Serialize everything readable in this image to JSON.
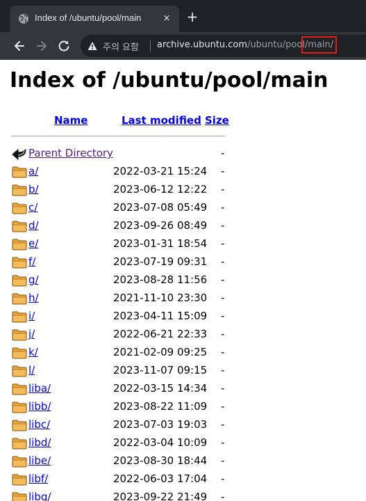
{
  "browser": {
    "tab_title": "Index of /ubuntu/pool/main",
    "tab_close": "×",
    "new_tab": "+",
    "security_warning": "주의 요함",
    "url_host": "archive.ubuntu.com",
    "url_path_pre": "/ubuntu/pool",
    "url_path_marked": "/main/",
    "accent_annotation_color": "#e01f1f"
  },
  "page": {
    "heading": "Index of /ubuntu/pool/main",
    "columns": {
      "name": "Name",
      "modified": "Last modified",
      "size": "Size"
    },
    "parent": {
      "label": "Parent Directory",
      "size": "-"
    },
    "entries": [
      {
        "name": "a/",
        "modified": "2022-03-21 15:24",
        "size": "-"
      },
      {
        "name": "b/",
        "modified": "2023-06-12 12:22",
        "size": "-"
      },
      {
        "name": "c/",
        "modified": "2023-07-08 05:49",
        "size": "-"
      },
      {
        "name": "d/",
        "modified": "2023-09-26 08:49",
        "size": "-"
      },
      {
        "name": "e/",
        "modified": "2023-01-31 18:54",
        "size": "-"
      },
      {
        "name": "f/",
        "modified": "2023-07-19 09:31",
        "size": "-"
      },
      {
        "name": "g/",
        "modified": "2023-08-28 11:56",
        "size": "-"
      },
      {
        "name": "h/",
        "modified": "2021-11-10 23:30",
        "size": "-"
      },
      {
        "name": "i/",
        "modified": "2023-04-11 15:09",
        "size": "-"
      },
      {
        "name": "j/",
        "modified": "2022-06-21 22:33",
        "size": "-"
      },
      {
        "name": "k/",
        "modified": "2021-02-09 09:25",
        "size": "-"
      },
      {
        "name": "l/",
        "modified": "2023-11-07 09:15",
        "size": "-"
      },
      {
        "name": "liba/",
        "modified": "2022-03-15 14:34",
        "size": "-"
      },
      {
        "name": "libb/",
        "modified": "2023-08-22 11:09",
        "size": "-"
      },
      {
        "name": "libc/",
        "modified": "2023-07-03 19:03",
        "size": "-"
      },
      {
        "name": "libd/",
        "modified": "2022-03-04 10:09",
        "size": "-"
      },
      {
        "name": "libe/",
        "modified": "2023-08-30 18:44",
        "size": "-"
      },
      {
        "name": "libf/",
        "modified": "2022-06-03 17:04",
        "size": "-"
      },
      {
        "name": "libg/",
        "modified": "2023-09-22 21:49",
        "size": "-"
      }
    ]
  }
}
